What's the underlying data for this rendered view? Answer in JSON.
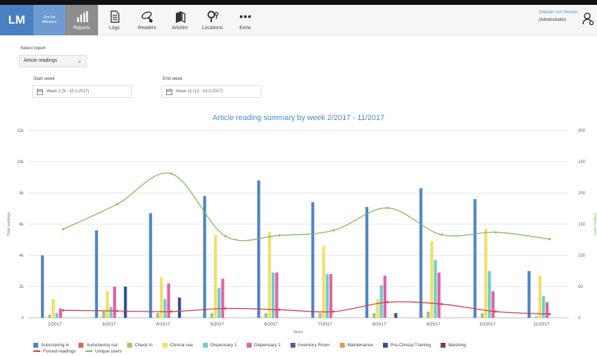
{
  "header": {
    "logo": "LM",
    "logo_tagline": "See the difference",
    "nav": [
      {
        "label": "Reports",
        "icon": "bar-chart-icon",
        "active": true
      },
      {
        "label": "Logs",
        "icon": "document-icon",
        "active": false
      },
      {
        "label": "Readers",
        "icon": "readers-icon",
        "active": false
      },
      {
        "label": "Articles",
        "icon": "articles-icon",
        "active": false
      },
      {
        "label": "Locations",
        "icon": "location-pin-icon",
        "active": false
      },
      {
        "label": "Extra",
        "icon": "more-dots-icon",
        "active": false
      }
    ],
    "user_name": "Stephan von Hessen",
    "user_role": "(Administrator)"
  },
  "filters": {
    "select_report_label": "Select report",
    "select_report_value": "Article readings",
    "start_week_label": "Start week",
    "start_week_value": "Week 2 (9 - 15.1.2017)",
    "end_week_label": "End week",
    "end_week_value": "Week 11 (13 - 19.3.2017)"
  },
  "chart_data": {
    "type": "bar",
    "title": "Article reading summary by week 2/2017 - 11/2017",
    "xlabel": "Week",
    "ylabel": "Total readings",
    "ylabel_right": "Unique users",
    "ylim": [
      0,
      12000
    ],
    "ylim_right": [
      0,
      300
    ],
    "yticks": [
      "0",
      "2k",
      "4k",
      "6k",
      "8k",
      "10k",
      "12k"
    ],
    "yticks_right": [
      "0",
      "50",
      "100",
      "150",
      "200",
      "250",
      "300"
    ],
    "categories": [
      "2/2017",
      "3/2017",
      "4/2017",
      "5/2017",
      "6/2017",
      "7/2017",
      "8/2017",
      "9/2017",
      "10/2017",
      "11/2017"
    ],
    "series": [
      {
        "name": "Autoclaving in",
        "color": "#4f86c6",
        "values": [
          4000,
          5600,
          6700,
          7800,
          8800,
          7400,
          7100,
          8300,
          7600,
          3000
        ]
      },
      {
        "name": "Autoclaving out",
        "color": "#e0625a",
        "values": [
          0,
          0,
          0,
          0,
          0,
          0,
          0,
          0,
          0,
          0
        ]
      },
      {
        "name": "Check In",
        "color": "#a5c768",
        "values": [
          200,
          400,
          300,
          300,
          300,
          300,
          300,
          400,
          300,
          100
        ]
      },
      {
        "name": "Clinical use",
        "color": "#f1df6b",
        "values": [
          1200,
          1700,
          2600,
          5300,
          5500,
          4600,
          1200,
          4900,
          5700,
          2700
        ]
      },
      {
        "name": "Dispensary 1",
        "color": "#6fcfc7",
        "values": [
          300,
          700,
          1200,
          1900,
          2900,
          2800,
          2100,
          3700,
          3000,
          1400
        ]
      },
      {
        "name": "Dispensary 2",
        "color": "#e062a8",
        "values": [
          600,
          2000,
          2200,
          2500,
          2900,
          2800,
          2700,
          2900,
          1700,
          1000
        ]
      },
      {
        "name": "Inventory Room",
        "color": "#5a5aa8",
        "values": [
          0,
          0,
          0,
          0,
          0,
          0,
          0,
          0,
          0,
          0
        ]
      },
      {
        "name": "Maintenance",
        "color": "#f0955a",
        "values": [
          0,
          0,
          0,
          0,
          0,
          0,
          0,
          0,
          0,
          0
        ]
      },
      {
        "name": "Pre-Clinical Training",
        "color": "#2f4f8f",
        "values": [
          0,
          2000,
          1300,
          0,
          0,
          0,
          300,
          0,
          0,
          0
        ]
      },
      {
        "name": "Washing",
        "color": "#8b3b3b",
        "values": [
          0,
          0,
          0,
          0,
          0,
          0,
          0,
          0,
          0,
          0
        ]
      }
    ],
    "line_series": [
      {
        "name": "Forced readings",
        "color": "#d9363a",
        "axis": "right",
        "values": [
          12,
          11,
          10,
          15,
          13,
          10,
          25,
          22,
          10,
          6
        ]
      },
      {
        "name": "Unique users",
        "color": "#7dbb55",
        "axis": "right",
        "values": [
          142,
          182,
          231,
          131,
          132,
          140,
          176,
          133,
          137,
          126
        ]
      }
    ],
    "grid": true,
    "legend": "bottom"
  }
}
